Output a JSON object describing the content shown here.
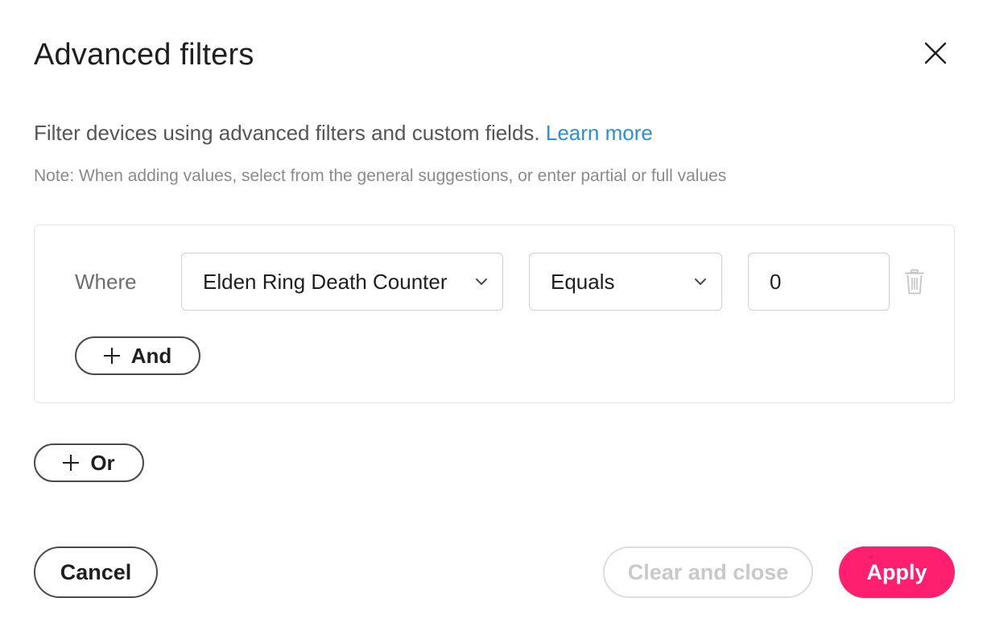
{
  "dialog": {
    "title": "Advanced filters",
    "close_icon": "close-icon",
    "description": "Filter devices using advanced filters and custom fields.",
    "learn_more": "Learn more",
    "note": "Note: When adding values, select from the general suggestions, or enter partial or full values"
  },
  "filter_group": {
    "where_label": "Where",
    "field_value": "Elden Ring Death Counter",
    "operator_value": "Equals",
    "input_value": "0",
    "delete_icon": "trash-icon",
    "dropdown_icon": "chevron-down-icon",
    "and_label": "And",
    "add_icon": "plus-icon"
  },
  "or_label": "Or",
  "footer": {
    "cancel_label": "Cancel",
    "clear_label": "Clear and close",
    "apply_label": "Apply"
  },
  "colors": {
    "accent": "#ff1f6e",
    "link": "#2b8fd6"
  }
}
